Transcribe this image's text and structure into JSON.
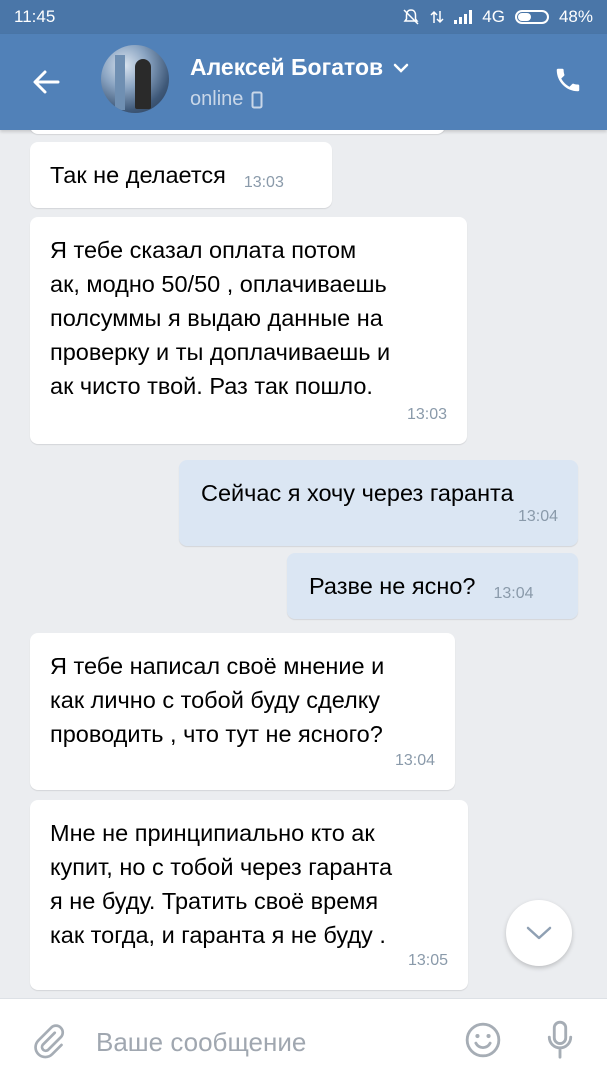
{
  "status_bar": {
    "time": "11:45",
    "network": "4G",
    "battery": "48%",
    "battery_level": 0.48
  },
  "header": {
    "contact_name": "Алексей Богатов",
    "status": "online"
  },
  "messages": [
    {
      "direction": "incoming",
      "text": "Так не делается",
      "time": "13:03"
    },
    {
      "direction": "incoming",
      "text": "Я тебе сказал оплата потом\nак, модно 50/50 , оплачиваешь\nполсуммы я выдаю данные на\nпроверку и ты доплачиваешь и\nак чисто твой. Раз так пошло.",
      "time": "13:03"
    },
    {
      "direction": "outgoing",
      "text": "Сейчас я хочу через гаранта",
      "time": "13:04"
    },
    {
      "direction": "outgoing",
      "text": "Разве не ясно?",
      "time": "13:04"
    },
    {
      "direction": "incoming",
      "text": "Я тебе написал своё мнение и\nкак лично с тобой буду сделку\nпроводить , что тут не ясного?",
      "time": "13:04"
    },
    {
      "direction": "incoming",
      "text": "Мне не принципиально кто ак\nкупит, но с тобой через гаранта\nя не буду. Тратить своё время\nкак тогда, и гаранта я не буду .",
      "time": "13:05"
    }
  ],
  "composer": {
    "placeholder": "Ваше сообщение"
  },
  "colors": {
    "header": "#5181b8",
    "status_bar": "#4a76a8",
    "chat_bg": "#ebedf0",
    "incoming_bubble": "#ffffff",
    "outgoing_bubble": "#dbe6f3",
    "icon_gray": "#99a2ad"
  }
}
